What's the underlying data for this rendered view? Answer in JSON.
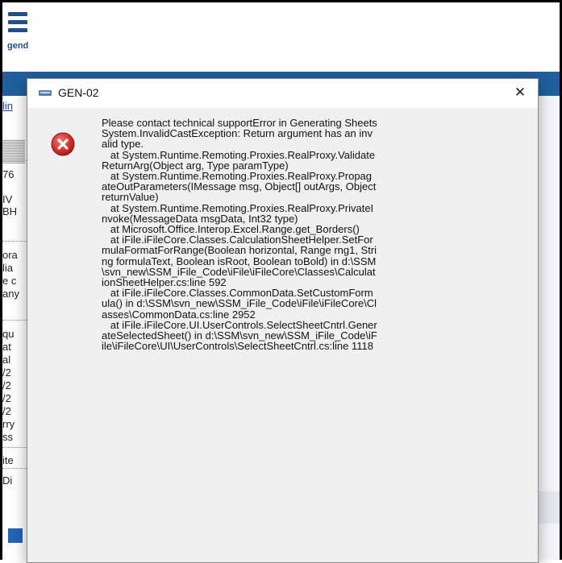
{
  "background_app": {
    "legend_label": "gend",
    "sidebar_lines": [
      "lin",
      "76",
      "IV",
      "BH",
      "ora",
      "lia",
      "e c",
      "any",
      "qu",
      "at",
      "al",
      "/2",
      "/2",
      "/2",
      "/2",
      "rry",
      "ss",
      "ite",
      "Di"
    ]
  },
  "dialog": {
    "title": "GEN-02",
    "close_label": "✕",
    "message": "Please contact technical supportError in Generating Sheets\nSystem.InvalidCastException: Return argument has an invalid type.\n   at System.Runtime.Remoting.Proxies.RealProxy.ValidateReturnArg(Object arg, Type paramType)\n   at System.Runtime.Remoting.Proxies.RealProxy.PropagateOutParameters(IMessage msg, Object[] outArgs, Object returnValue)\n   at System.Runtime.Remoting.Proxies.RealProxy.PrivateInvoke(MessageData msgData, Int32 type)\n   at Microsoft.Office.Interop.Excel.Range.get_Borders()\n   at iFile.iFileCore.Classes.CalculationSheetHelper.SetFormulaFormatForRange(Boolean horizontal, Range rng1, String formulaText, Boolean isRoot, Boolean toBold) in d:\\SSM\\svn_new\\SSM_iFile_Code\\iFile\\iFileCore\\Classes\\CalculationSheetHelper.cs:line 592\n   at iFile.iFileCore.Classes.CommonData.SetCustomFormula() in d:\\SSM\\svn_new\\SSM_iFile_Code\\iFile\\iFileCore\\Classes\\CommonData.cs:line 2952\n   at iFile.iFileCore.UI.UserControls.SelectSheetCntrl.GenerateSelectedSheet() in d:\\SSM\\svn_new\\SSM_iFile_Code\\iFile\\iFileCore\\UI\\UserControls\\SelectSheetCntrl.cs:line 1118"
  },
  "icons": {
    "title": "app-window-icon",
    "error": "error-icon",
    "close": "close-icon",
    "menu": "hamburger-menu-icon"
  },
  "colors": {
    "error_red": "#d9302b",
    "app_bar": "#1f5f9e",
    "dialog_bg": "#f0f0f0"
  }
}
